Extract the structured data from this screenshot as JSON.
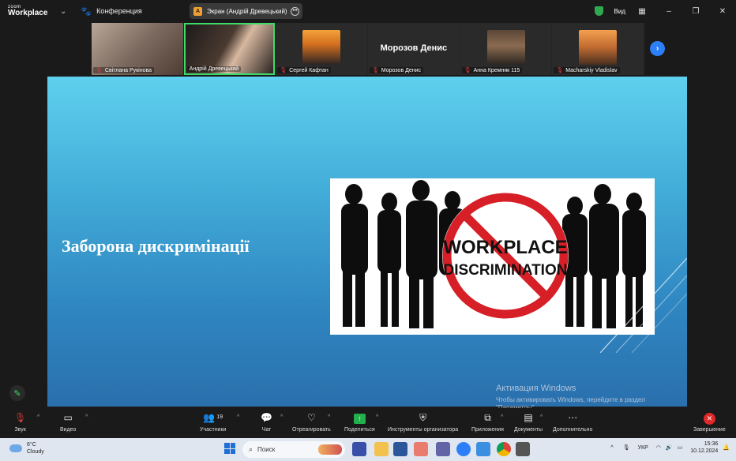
{
  "titlebar": {
    "logo_top": "zoom",
    "logo_bottom": "Workplace",
    "conference_label": "Конференция",
    "share_label": "Экран (Андрій Древецький)",
    "share_icon_letter": "A",
    "view_label": "Вид"
  },
  "participants": [
    {
      "name": "Світлана Рукінова"
    },
    {
      "name": "Андрій Древецький"
    },
    {
      "name": "Сергей Кафтан"
    },
    {
      "name": "Морозов Денис",
      "display_name": "Морозов Денис"
    },
    {
      "name": "Анна Кремняк 115"
    },
    {
      "name": "Macharskiy Vladislav"
    }
  ],
  "slide": {
    "title": "Заборона дискримінації",
    "image_text_line1": "WORKPLACE",
    "image_text_line2": "DISCRIMINATION"
  },
  "watermark": {
    "line1": "Активация Windows",
    "line2": "Чтобы активировать Windows, перейдите в раздел \"Параметры\"."
  },
  "toolbar": {
    "audio": "Звук",
    "video": "Видео",
    "participants": "Участники",
    "participants_count": "19",
    "chat": "Чат",
    "react": "Отреагировать",
    "share": "Поделиться",
    "host_tools": "Инструменты организатора",
    "apps": "Приложения",
    "docs": "Документы",
    "more": "Дополнительно",
    "end": "Завершение"
  },
  "taskbar": {
    "temp": "6°C",
    "weather": "Cloudy",
    "search_placeholder": "Поиск",
    "language": "УКР",
    "time": "15:36",
    "date": "10.12.2024"
  },
  "colors": {
    "accent_green": "#3ddc6a",
    "end_red": "#e02828",
    "zoom_blue": "#2d7ff9"
  }
}
